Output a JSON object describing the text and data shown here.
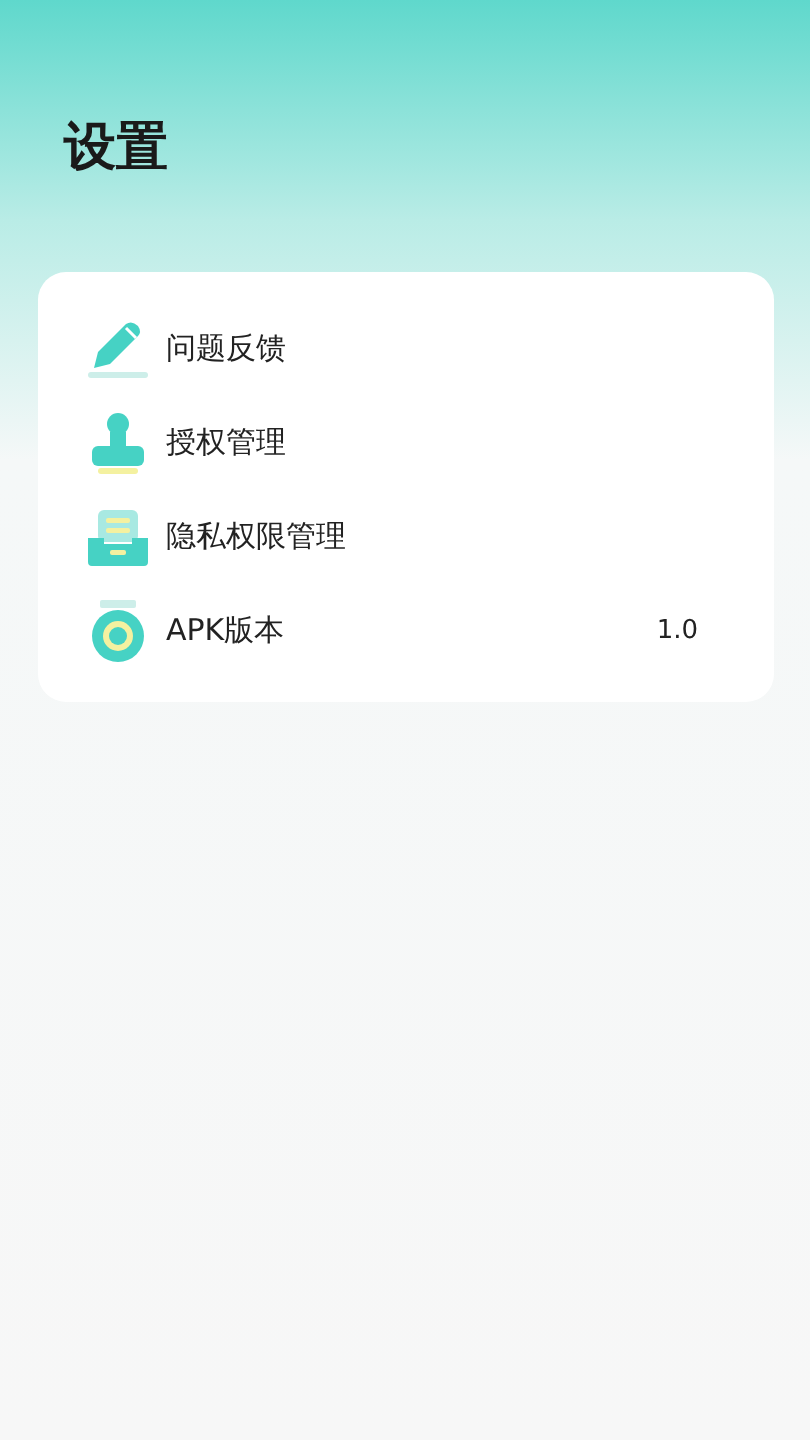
{
  "page": {
    "title": "设置"
  },
  "settings": [
    {
      "kind": "pencil",
      "label": "问题反馈"
    },
    {
      "kind": "stamp",
      "label": "授权管理"
    },
    {
      "kind": "tray",
      "label": "隐私权限管理"
    },
    {
      "kind": "badge",
      "label": "APK版本",
      "value": "1.0"
    }
  ]
}
